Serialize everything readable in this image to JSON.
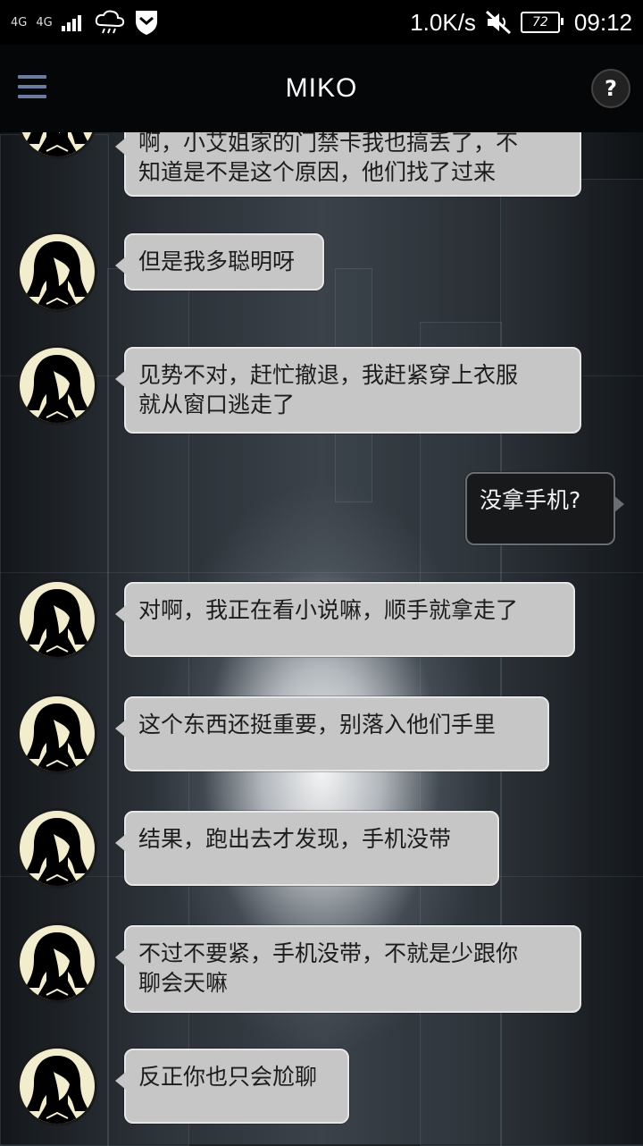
{
  "status_bar": {
    "signal_1": "4G",
    "signal_2": "4G",
    "net_speed": "1.0K/s",
    "battery": "72",
    "time": "09:12",
    "icons": [
      "signal-icon",
      "weather-icon",
      "shield-icon",
      "mute-icon",
      "battery-icon"
    ]
  },
  "app_bar": {
    "title": "MIKO",
    "menu_icon": "hamburger-icon",
    "help_label": "?"
  },
  "messages": [
    {
      "side": "in",
      "text": "啊，小艾姐家的门禁卡我也搞丢了，不\n知道是不是这个原因，他们找了过来"
    },
    {
      "side": "in",
      "text": "但是我多聪明呀"
    },
    {
      "side": "in",
      "text": "见势不对，赶忙撤退，我赶紧穿上衣服\n就从窗口逃走了"
    },
    {
      "side": "out",
      "text": "没拿手机?"
    },
    {
      "side": "in",
      "text": "对啊，我正在看小说嘛，顺手就拿走了"
    },
    {
      "side": "in",
      "text": "这个东西还挺重要，别落入他们手里"
    },
    {
      "side": "in",
      "text": "结果，跑出去才发现，手机没带"
    },
    {
      "side": "in",
      "text": "不过不要紧，手机没带，不就是少跟你\n聊会天嘛"
    },
    {
      "side": "in",
      "text": "反正你也只会尬聊"
    }
  ]
}
